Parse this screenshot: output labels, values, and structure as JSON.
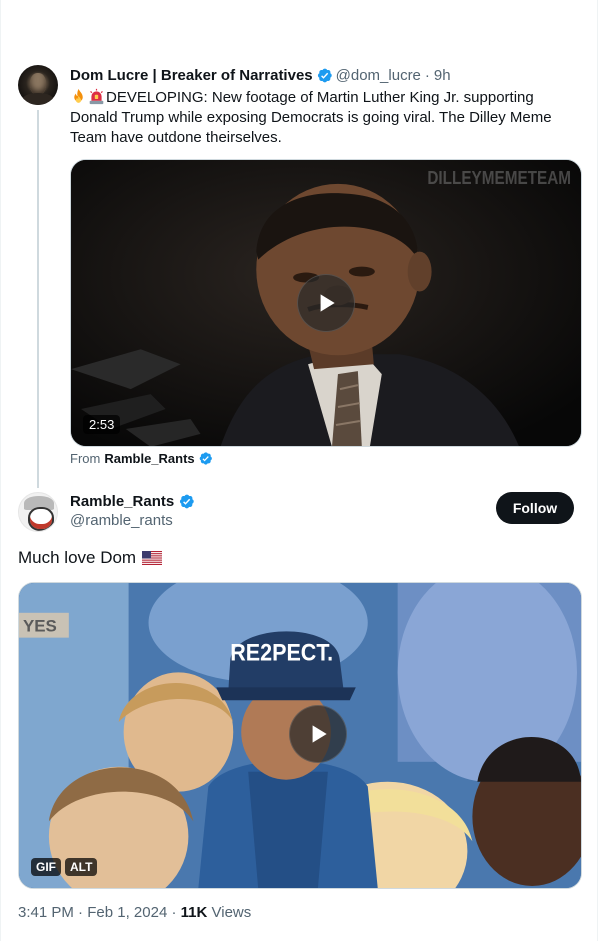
{
  "parent_tweet": {
    "display_name": "Dom Lucre | Breaker of Narratives",
    "handle": "@dom_lucre",
    "separator": "·",
    "time": "9h",
    "text": "DEVELOPING: New footage of Martin Luther King Jr. supporting Donald Trump while exposing Democrats is going viral. The Dilley Meme Team have outdone theirselves.",
    "emojis": [
      "fire-emoji",
      "siren-emoji"
    ],
    "video": {
      "watermark": "DILLEYMEMETEAM",
      "duration": "2:53"
    },
    "from_prefix": "From",
    "from_user": "Ramble_Rants"
  },
  "reply_tweet": {
    "display_name": "Ramble_Rants",
    "handle": "@ramble_rants",
    "follow_label": "Follow",
    "text": "Much love Dom",
    "flag_emoji": "us-flag-emoji",
    "gif": {
      "cap_text": "RE2PECT.",
      "sign_text": "YES",
      "badges": [
        "GIF",
        "ALT"
      ]
    },
    "meta": {
      "time": "3:41 PM",
      "sep1": "·",
      "date": "Feb 1, 2024",
      "sep2": "·",
      "views_count": "11K",
      "views_label": "Views"
    }
  },
  "colors": {
    "text_primary": "#0f1419",
    "text_secondary": "#536471",
    "verified_blue": "#1d9bf0",
    "border": "#cfd9de"
  }
}
